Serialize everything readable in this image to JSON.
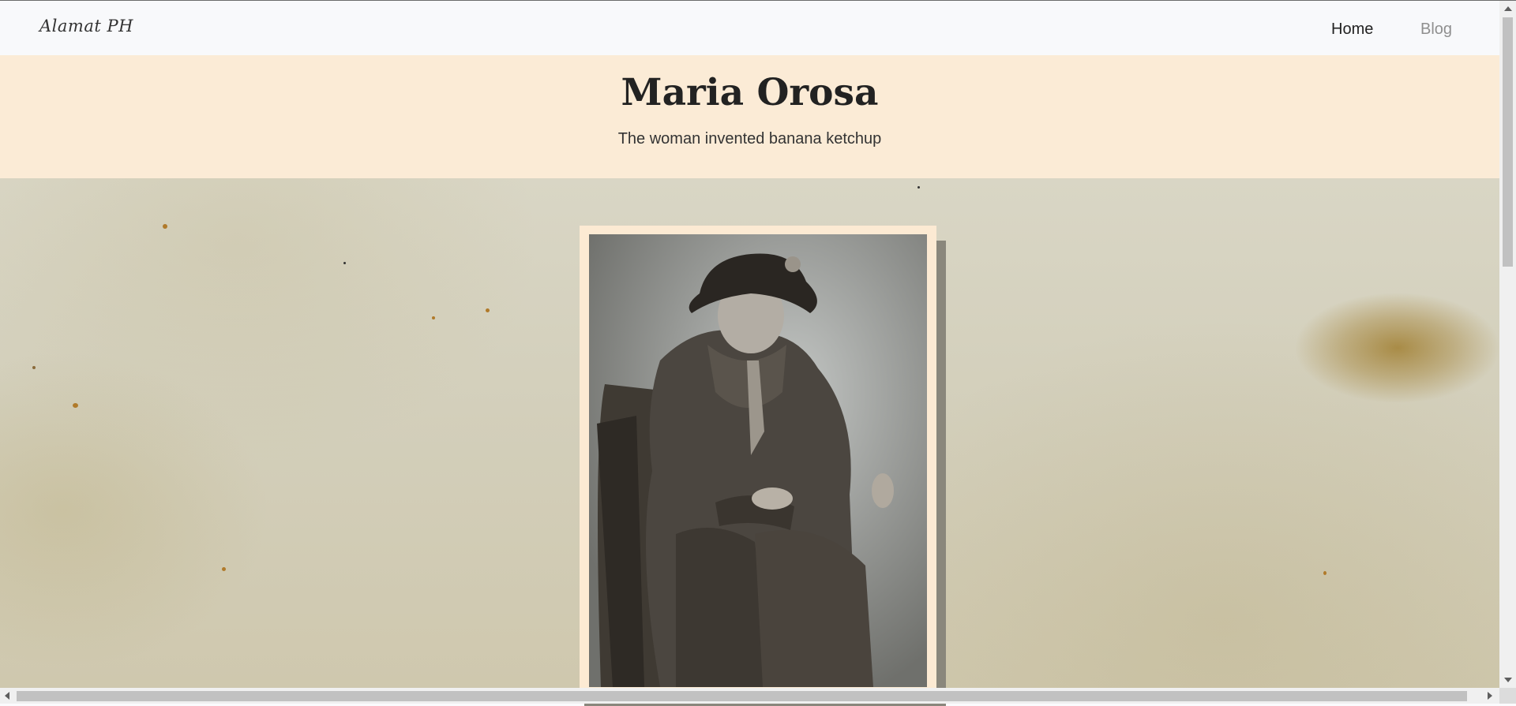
{
  "navbar": {
    "brand": "Alamat PH",
    "links": [
      {
        "label": "Home"
      },
      {
        "label": "Blog"
      }
    ]
  },
  "hero": {
    "title": "Maria Orosa",
    "subtitle": "The woman invented banana ketchup"
  },
  "photo": {
    "subject": "Vintage sepia portrait of a seated woman in hat and coat"
  },
  "colors": {
    "navbar_bg": "#f8f9fb",
    "hero_bg": "#fbebd6",
    "frame_bg": "#fcead3",
    "nav_active": "#222222",
    "nav_muted": "#8f8f8f"
  }
}
